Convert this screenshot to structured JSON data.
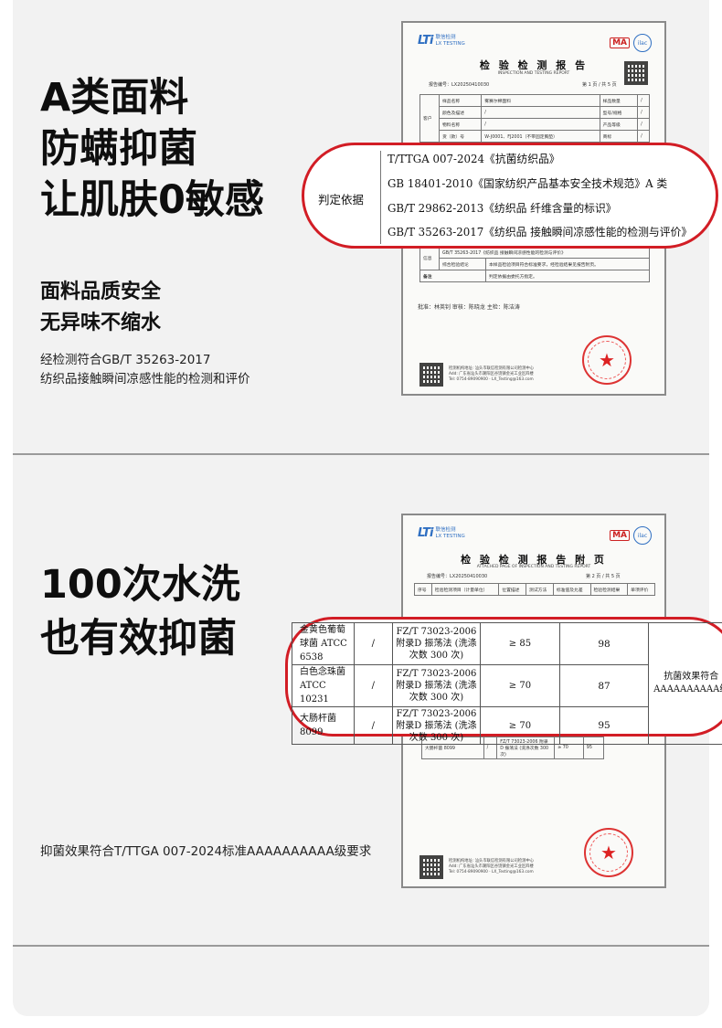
{
  "section1": {
    "headline": [
      "A类面料",
      "防螨抑菌",
      "让肌肤0敏感"
    ],
    "subline": [
      "面料品质安全",
      "无异味不缩水"
    ],
    "note": [
      "经检测符合GB/T 35263-2017",
      "纺织品接触瞬间凉感性能的检测和评价"
    ]
  },
  "section2": {
    "headline": [
      "100次水洗",
      "也有效抑菌"
    ],
    "note": "抑菌效果符合T/TTGA 007-2024标准AAAAAAAAAA级要求"
  },
  "report1": {
    "brand": "联信检测",
    "brand_en": "LX TESTING",
    "title": "检 验 检 测 报 告",
    "subtitle": "INSPECTION AND TESTING REPORT",
    "report_no": "报告编号：LX20250410030",
    "page": "第 1 页 / 共 5 页",
    "callout_label": "判定依据",
    "standards": [
      "T/TTGA 007-2024《抗菌纺织品》",
      "GB 18401-2010《国家纺织产品基本安全技术规范》A 类",
      "GB/T 29862-2013《纺织品 纤维含量的标识》",
      "GB/T 35263-2017《纺织品 接触瞬间凉感性能的检测与评价》"
    ],
    "rows_top": [
      [
        "样品名称",
        "雾赛尔棉面料",
        "样品数量",
        "/"
      ],
      [
        "颜色及描述",
        "/",
        "型号/规格",
        "/"
      ],
      [
        "物料名称",
        "/",
        "产品等级",
        "/"
      ],
      [
        "货（款）号",
        "W-J0001、FJ2001（不带固定胸垫）",
        "商标",
        "/"
      ]
    ],
    "rows_bottom": [
      [
        "GB/T 35263-2017《纺织品 接触瞬间凉感性能的检测与评价》"
      ],
      [
        "综合检验结论",
        "本样品检验项目符合标准要求，经检验结果见报告附页。"
      ],
      [
        "备注",
        "判定依据由委托方指定。"
      ]
    ],
    "signatures": "批准：林英钊  审核：陈晓龙  主检：陈洁涛"
  },
  "report2": {
    "brand": "联信检测",
    "brand_en": "LX TESTING",
    "title": "检 验 检 测 报 告 附 页",
    "subtitle": "ATTACHED PAGE OF INSPECTION AND TESTING REPORT",
    "report_no": "报告编号：LX20250410030",
    "page": "第 2 页 / 共 5 页",
    "header": [
      "序号",
      "检验检测项目（计量单位）",
      "位置描述",
      "测试方法",
      "标准值及允差",
      "检验检测结果",
      "单项评价"
    ],
    "callout_rows": [
      {
        "organism": "金黄色葡萄球菌 ATCC 6538",
        "pos": "/",
        "method": "FZ/T 73023-2006 附录D 振荡法 (洗涤次数 300 次)",
        "std": "≥ 85",
        "result": "98"
      },
      {
        "organism": "白色念珠菌 ATCC 10231",
        "pos": "/",
        "method": "FZ/T 73023-2006 附录D 振荡法 (洗涤次数 300 次)",
        "std": "≥ 70",
        "result": "87"
      },
      {
        "organism": "大肠杆菌 8099",
        "pos": "/",
        "method": "FZ/T 73023-2006 附录D 振荡法 (洗涤次数 300 次)",
        "std": "≥ 70",
        "result": "95"
      }
    ],
    "callout_eval": "抗菌效果符合AAAAAAAAAA级"
  },
  "colors": {
    "callout_border": "#d21d25",
    "panel_bg": "#f2f2f2",
    "divider": "#9a9a9a"
  }
}
